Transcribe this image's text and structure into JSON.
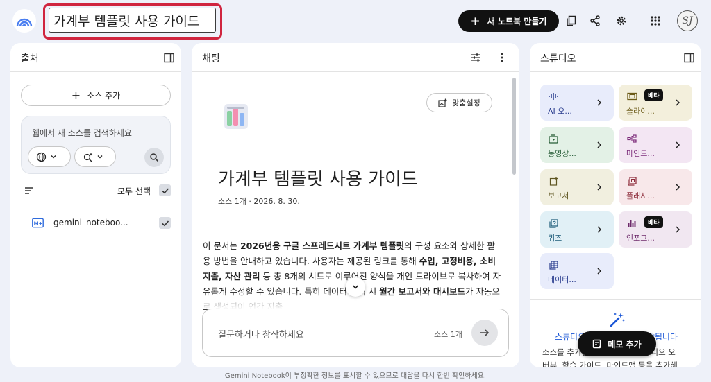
{
  "header": {
    "notebook_title": "가계부 템플릿 사용 가이드",
    "new_notebook_label": "새 노트북 만들기",
    "new_notebook_icon": "plus-icon",
    "avatar_text": "SJ"
  },
  "sources": {
    "title": "출처",
    "add_source_label": "소스 추가",
    "web_search_placeholder": "웹에서 새 소스를 검색하세요",
    "select_all_label": "모두 선택",
    "items": [
      {
        "name": "gemini_noteboo...",
        "icon": "markdown-icon",
        "checked": true
      }
    ]
  },
  "chat": {
    "title": "채팅",
    "customize_label": "맞춤설정",
    "doc_title": "가계부 템플릿 사용 가이드",
    "doc_meta": "소스 1개 · 2026. 8. 30.",
    "summary": [
      {
        "t": "이 문서는 ",
        "b": false
      },
      {
        "t": "2026년용 구글 스프레드시트 가계부 템플릿",
        "b": true
      },
      {
        "t": "의 구성 요소와 상세한 활용 방법을 안내하고 있습니다. 사용자는 제공된 링크를 통해 ",
        "b": false
      },
      {
        "t": "수입, 고정비용, 소비지출, 자산 관리",
        "b": true
      },
      {
        "t": " 등 총 8개의 시트로 이루어진 양식을 개인 드라이브로 복사하여 자유롭게 수정할 수 있습니다. 특히 데이터 입력 시 ",
        "b": false
      },
      {
        "t": "월간 보고서와 대시보드",
        "b": true
      },
      {
        "t": "가 자동으로 생성되어 연간 지출",
        "b": false
      }
    ],
    "input_placeholder": "질문하거나 창작하세요",
    "source_count": "소스 1개"
  },
  "studio": {
    "title": "스튜디오",
    "tiles": [
      {
        "label": "AI 오...",
        "icon": "audio-wave-icon",
        "beta": false,
        "bg": "#e8ecfb",
        "fg": "#2b3e8f"
      },
      {
        "label": "슬라이...",
        "icon": "slides-icon",
        "beta": true,
        "beta_label": "베타",
        "bg": "#f3efdc",
        "fg": "#6b5a17"
      },
      {
        "label": "동영상...",
        "icon": "video-icon",
        "beta": false,
        "bg": "#e3f1e6",
        "fg": "#255c35"
      },
      {
        "label": "마인드...",
        "icon": "mindmap-icon",
        "beta": false,
        "bg": "#f3e6f3",
        "fg": "#7c2b7a"
      },
      {
        "label": "보고서",
        "icon": "report-icon",
        "beta": false,
        "bg": "#f1efdf",
        "fg": "#5e5520"
      },
      {
        "label": "플래시...",
        "icon": "flashcard-icon",
        "beta": false,
        "bg": "#f8e8ea",
        "fg": "#8d2b3a"
      },
      {
        "label": "퀴즈",
        "icon": "quiz-icon",
        "beta": false,
        "bg": "#e1f0f6",
        "fg": "#1c5b78"
      },
      {
        "label": "인포그...",
        "icon": "infographic-icon",
        "beta": true,
        "beta_label": "베타",
        "bg": "#f1e7f1",
        "fg": "#6d2a6a"
      },
      {
        "label": "데이터...",
        "icon": "table-icon",
        "beta": false,
        "bg": "#e8ecfb",
        "fg": "#2b3e8f"
      }
    ],
    "output_heading": "스튜디오 출력이 여기에 저장됩니다",
    "output_desc_1": "소스를 추가한 후 클릭하여 AI 오디오 오",
    "output_desc_2": "버뷰, 학습 가이드, 마인드맵 등을 추가해",
    "memo_label": "메모 추가"
  },
  "footer": "Gemini Notebook이 부정확한 정보를 표시할 수 있으므로 대답을 다시 한번 확인하세요.",
  "colors": {
    "accent": "#d0253f",
    "link": "#1a56d6",
    "dark_button": "#111111",
    "background": "#eef1f9"
  }
}
